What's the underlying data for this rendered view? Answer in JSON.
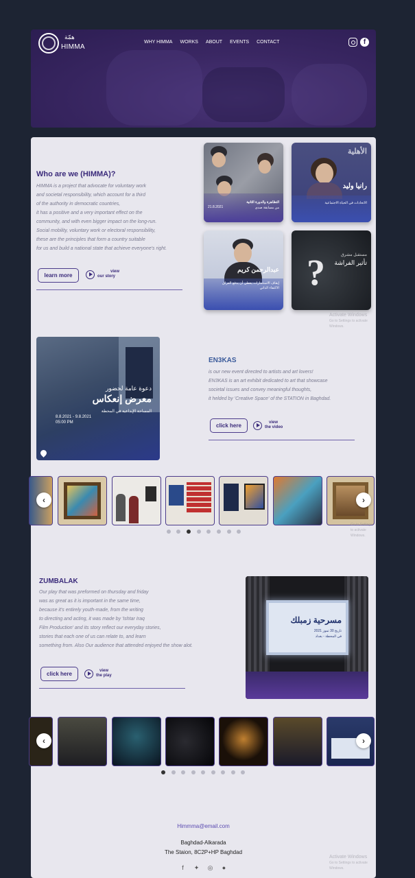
{
  "header": {
    "brand_ar": "همّة",
    "brand_en": "HIMMA",
    "nav": [
      "WHY HIMMA",
      "WORKS",
      "ABOUT",
      "EVENTS",
      "CONTACT"
    ]
  },
  "about": {
    "title": "Who are we (HIMMA)?",
    "lines": [
      "HIMMA is a project that advocate for voluntary work",
      "and societal responsibility, which account for a third",
      "of the authority in democratic countries,",
      "it has a positive and a very important effect on the",
      "community, and with even bigger impact on the long-run.",
      "Social mobility, voluntary work or electoral responsibility,",
      "these are the principles that form a country suitable",
      "for us and build a national state that achieve everyone's right."
    ],
    "learn_more": "learn more",
    "view_line1": "view",
    "view_line2": "our story",
    "cards": [
      {
        "title": "التظاهرة والدورة الثانية",
        "sub": "من مسابقة صدى",
        "date": "21.8.2021"
      },
      {
        "title": "رانيا وليد",
        "sub": "الاتحادات في الحياة الاجتماعية",
        "top": "الأهلية"
      },
      {
        "title": "عبدالرحمن كريم",
        "sub": "إيقاف الاستثمارات يعطي أن يدفع العراق الاكتفاء الذاتي"
      },
      {
        "title": "تأثير الفراشة",
        "sub": "مستقبل مشرق"
      }
    ]
  },
  "en3kas": {
    "title": "EN3KAS",
    "lines": [
      "is our new event directed to artists and art lovers!",
      "EN3KAS is an art exhibit dedicated to art that showcase",
      "societal issues and convey meaningful thoughts,",
      "it helded by 'Creative Space' of the STATION in Baghdad."
    ],
    "click_here": "click here",
    "view_line1": "view",
    "view_line2": "the video",
    "poster": {
      "invite": "دعوة عامة لحضور",
      "name": "معرض إنعكاس",
      "place": "المساحة الإبداعية في المحطة",
      "dates": "8.8.2021 - 9.8.2021",
      "time": "05:00 PM"
    }
  },
  "zumbalak": {
    "title": "ZUMBALAK",
    "lines": [
      "Our play that was preformed on thursday and friday",
      "was as great as it is important in the same time,",
      "because it's entirely youth-made, from the writing",
      "to directing and acting, it was made by 'Ishtar Iraq",
      "Film Production' and its story reflect our everyday stories,",
      "stories that each one of us can relate to, and learn",
      "something from. Also Our audience that attended enjoyed the show alot."
    ],
    "click_here": "click here",
    "view_line1": "view",
    "view_line2": "the play",
    "poster": {
      "name": "مسرحية زمبلك",
      "date": "تاريخ 30 تموز 2021",
      "place": "في المحطة - بغداد"
    }
  },
  "watermark": {
    "line1": "Activate Windows",
    "line2": "Go to Settings to activate Windows."
  },
  "footer": {
    "email": "Himmma@email.com",
    "address1": "Baghdad-Alkarada",
    "address2": "The Staion, 8C2P+HP Baghdad"
  }
}
